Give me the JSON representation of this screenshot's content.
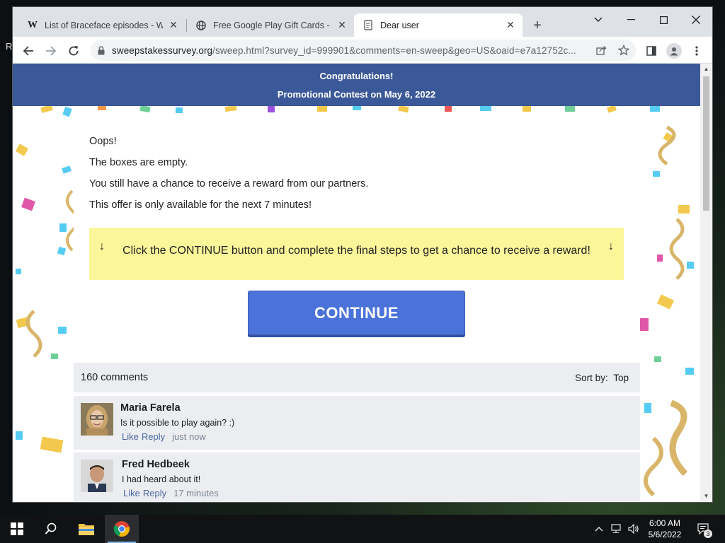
{
  "desktop": {
    "edge_letter": "R"
  },
  "browser": {
    "tabs": [
      {
        "title": "List of Braceface episodes - Wiki",
        "icon": "wikipedia-icon"
      },
      {
        "title": "Free Google Play Gift Cards - Gif",
        "icon": "globe-icon"
      },
      {
        "title": "Dear user",
        "icon": "document-icon",
        "active": true
      }
    ],
    "new_tab_label": "+",
    "url_host": "sweepstakessurvey.org",
    "url_path": "/sweep.html?survey_id=999901&comments=en-sweep&geo=US&oaid=e7a12752c..."
  },
  "banner": {
    "line1": "Congratulations!",
    "line2_prefix": "Promotional Contest on ",
    "line2_date": "May 6, 2022",
    "color": "#3b5998"
  },
  "main": {
    "oops": "Oops!",
    "empty": "The boxes are empty.",
    "chance": "You still have a chance to receive a reward from our partners.",
    "offer": "This offer is only available for the next 7 minutes!",
    "notice_arrow": "↓",
    "notice": "Click the CONTINUE button and complete the final steps to get a chance to receive a reward!",
    "notice_color": "#fbf69a",
    "continue_label": "CONTINUE",
    "continue_color": "#4a72d9"
  },
  "comments": {
    "count_label": "160 comments",
    "sort_label": "Sort by:",
    "sort_value": "Top",
    "items": [
      {
        "name": "Maria Farela",
        "text": "Is it possible to play again? :)",
        "like": "Like",
        "reply": "Reply",
        "ago": "just now"
      },
      {
        "name": "Fred Hedbeek",
        "text": "I had heard about it!",
        "like": "Like",
        "reply": "Reply",
        "ago": "17 minutes"
      }
    ]
  },
  "taskbar": {
    "time": "6:00 AM",
    "date": "5/6/2022",
    "notification_count": "3"
  }
}
